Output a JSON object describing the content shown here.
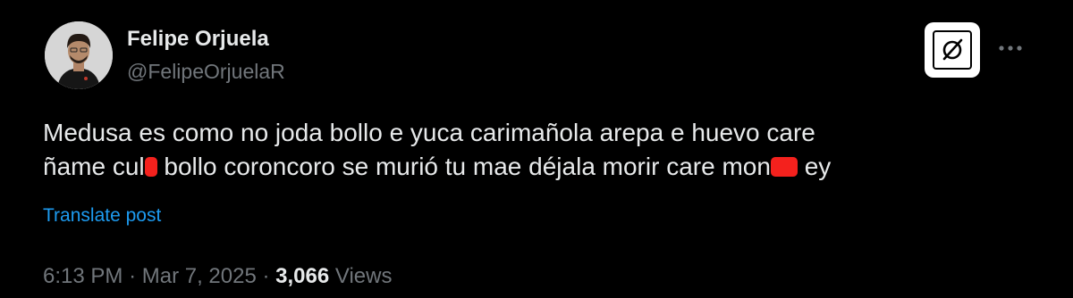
{
  "post": {
    "author_name": "Felipe Orjuela",
    "author_handle": "@FelipeOrjuelaR",
    "text_line1": "Medusa es como no joda bollo e yuca carimañola arepa e huevo care",
    "text_line2_a": "ñame cul",
    "text_line2_b": " bollo coroncoro se murió tu mae déjala morir care mon",
    "text_line2_c": " ey",
    "translate_label": "Translate post",
    "time": "6:13 PM",
    "date": "Mar 7, 2025",
    "separator": "·",
    "views_count": "3,066",
    "views_label": "Views"
  },
  "icons": {
    "grok": "grok-icon",
    "more": "more-icon",
    "avatar": "avatar"
  },
  "colors": {
    "background": "#000000",
    "text": "#e7e9ea",
    "muted": "#71767b",
    "link": "#1d9bf0",
    "redaction": "#f4211d"
  }
}
